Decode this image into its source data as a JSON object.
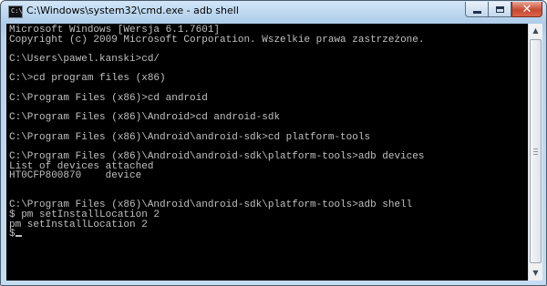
{
  "window": {
    "title": "C:\\Windows\\system32\\cmd.exe - adb  shell",
    "icon_name": "cmd-console-icon",
    "icon_glyph": "C:\\"
  },
  "console": {
    "lines": [
      "Microsoft Windows [Wersja 6.1.7601]",
      "Copyright (c) 2009 Microsoft Corporation. Wszelkie prawa zastrzeżone.",
      "",
      "C:\\Users\\pawel.kanski>cd/",
      "",
      "C:\\>cd program files (x86)",
      "",
      "C:\\Program Files (x86)>cd android",
      "",
      "C:\\Program Files (x86)\\Android>cd android-sdk",
      "",
      "C:\\Program Files (x86)\\Android\\android-sdk>cd platform-tools",
      "",
      "C:\\Program Files (x86)\\Android\\android-sdk\\platform-tools>adb devices",
      "List of devices attached",
      "HT0CFP800870    device",
      "",
      "",
      "C:\\Program Files (x86)\\Android\\android-sdk\\platform-tools>adb shell",
      "$ pm setInstallLocation 2",
      "pm setInstallLocation 2",
      "$"
    ],
    "colors": {
      "background": "#000000",
      "text": "#c0c0c0"
    }
  },
  "titlebar_buttons": {
    "minimize": "minimize-icon",
    "maximize": "maximize-icon",
    "close": "close-icon",
    "close_color": "#c84a33"
  },
  "scrollbar": {
    "up_arrow": "▲",
    "down_arrow": "▼"
  }
}
